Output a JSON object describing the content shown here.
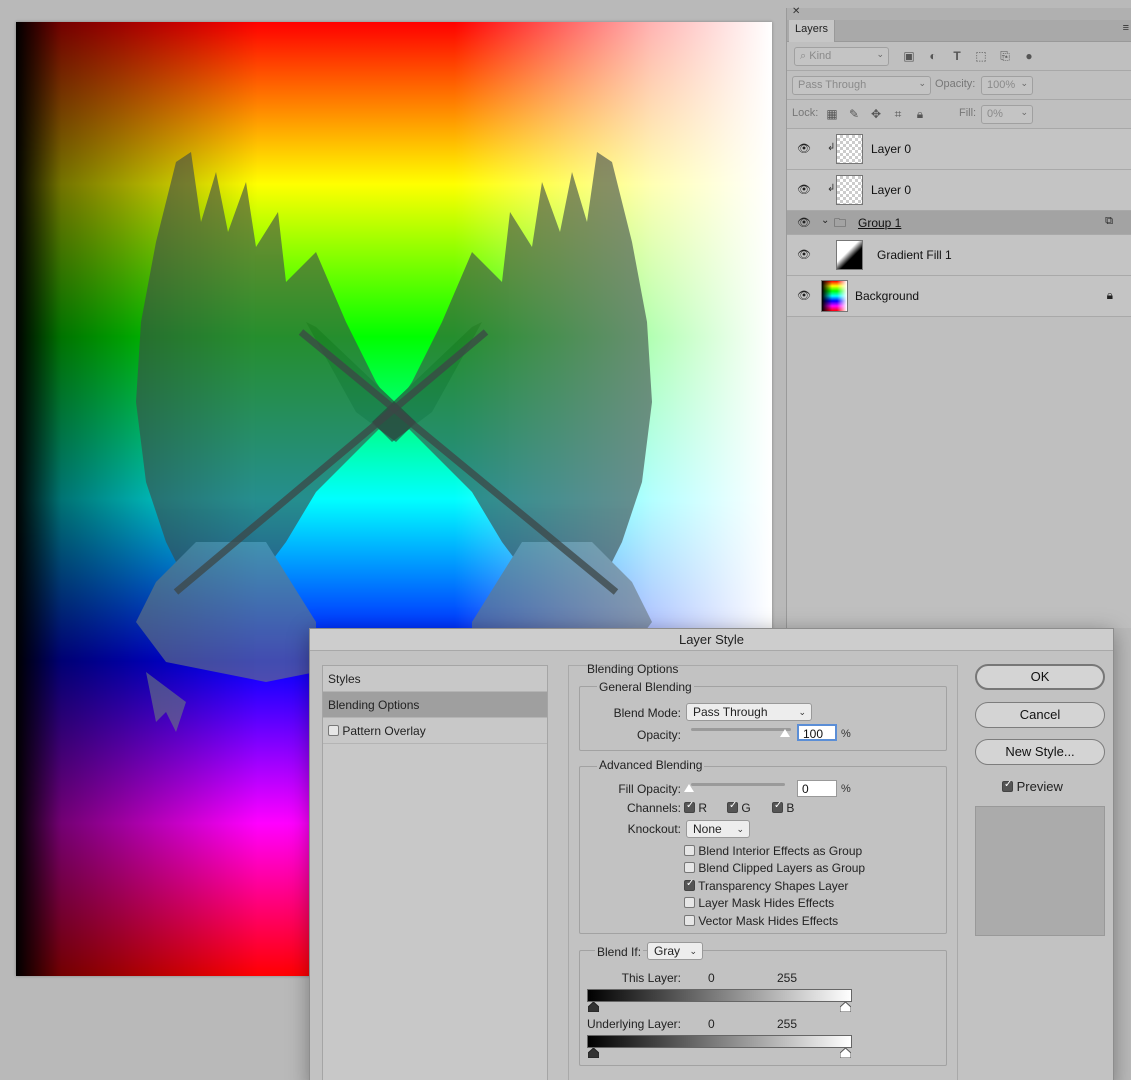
{
  "layers_panel": {
    "tab": "Layers",
    "filter_kind": "Kind",
    "blend_mode": "Pass Through",
    "opacity_label": "Opacity:",
    "opacity_value": "100%",
    "lock_label": "Lock:",
    "fill_label": "Fill:",
    "fill_value": "0%",
    "layers": [
      {
        "name": "Layer 0"
      },
      {
        "name": "Layer 0"
      },
      {
        "name": "Group 1"
      },
      {
        "name": "Gradient Fill 1"
      },
      {
        "name": "Background"
      }
    ]
  },
  "dialog": {
    "title": "Layer Style",
    "styles_list": [
      "Styles",
      "Blending Options",
      "Pattern Overlay"
    ],
    "blending_options": {
      "title": "Blending Options",
      "general_title": "General Blending",
      "blend_mode_label": "Blend Mode:",
      "blend_mode_value": "Pass Through",
      "opacity_label": "Opacity:",
      "opacity_value": "100",
      "percent": "%"
    },
    "advanced": {
      "title": "Advanced Blending",
      "fill_opacity_label": "Fill Opacity:",
      "fill_opacity_value": "0",
      "percent": "%",
      "channels_label": "Channels:",
      "channels": [
        "R",
        "G",
        "B"
      ],
      "knockout_label": "Knockout:",
      "knockout_value": "None",
      "options": [
        {
          "label": "Blend Interior Effects as Group",
          "checked": false
        },
        {
          "label": "Blend Clipped Layers as Group",
          "checked": false
        },
        {
          "label": "Transparency Shapes Layer",
          "checked": true
        },
        {
          "label": "Layer Mask Hides Effects",
          "checked": false
        },
        {
          "label": "Vector Mask Hides Effects",
          "checked": false
        }
      ]
    },
    "blend_if": {
      "label": "Blend If:",
      "value": "Gray",
      "this_layer_label": "This Layer:",
      "this_low": "0",
      "this_high": "255",
      "underlying_label": "Underlying Layer:",
      "under_low": "0",
      "under_high": "255"
    },
    "buttons": {
      "ok": "OK",
      "cancel": "Cancel",
      "new_style": "New Style...",
      "preview": "Preview"
    }
  }
}
